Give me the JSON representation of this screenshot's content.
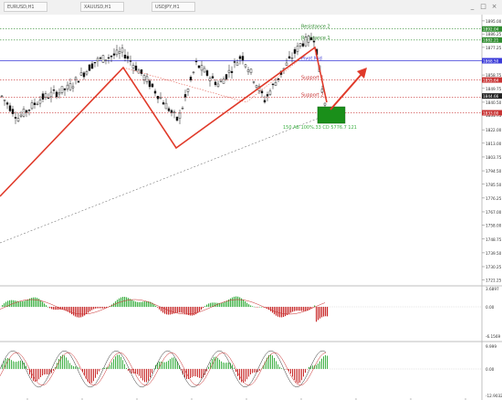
{
  "window": {
    "tabs": [
      "EURUSD,H1",
      "XAUUSD,H1",
      "USDJPY,H1"
    ],
    "controls": {
      "minimize": "_",
      "maximize": "□",
      "close": "×"
    }
  },
  "price_axis": {
    "ticks": [
      "1895.00",
      "1886.25",
      "1877.25",
      "1868.50",
      "1858.75",
      "1849.75",
      "1840.50",
      "1831.75",
      "1822.00",
      "1813.00",
      "1803.75",
      "1794.50",
      "1785.50",
      "1776.25",
      "1767.00",
      "1758.00",
      "1748.75",
      "1739.50",
      "1730.25",
      "1721.25"
    ],
    "current_price": "1844.66",
    "colors": {
      "bull": "#1a1a1a",
      "bear": "#1a1a1a",
      "grid": "#dcdcdc"
    }
  },
  "levels": [
    {
      "label": "Resistance 2",
      "value": 1889.6,
      "color": "#2e8b2e",
      "style": "dotted",
      "tag": "1892.04"
    },
    {
      "label": "Resistance 1",
      "value": 1882.2,
      "color": "#2e8b2e",
      "style": "dotted",
      "tag": "1882.21"
    },
    {
      "label": "Pivot Mid",
      "value": 1868.3,
      "color": "#3a3ad8",
      "style": "solid",
      "tag": "1868.50"
    },
    {
      "label": "Support 1",
      "value": 1855.4,
      "color": "#c83232",
      "style": "dotted",
      "tag": "1855.64"
    },
    {
      "label": "Support 2",
      "value": 1843.8,
      "color": "#c83232",
      "style": "dotted",
      "tag": ""
    },
    {
      "label": "",
      "value": 1833.4,
      "color": "#c83232",
      "style": "dotted",
      "tag": "1833.00"
    }
  ],
  "annotation": {
    "text": "150   AB 100%.33 CD 5776.7   121",
    "color": "#3cb043"
  },
  "indicators": {
    "macd": {
      "ticks": [
        "3.6897",
        "0.00",
        "-6.1569"
      ]
    },
    "stochastic": {
      "ticks": [
        "9.999",
        "0.00",
        "-12.9032"
      ]
    }
  },
  "colors": {
    "zigzag": "#e03a2a",
    "target_box": "#1a8f1a",
    "arrow": "#e03a2a",
    "trendline": "#555555"
  }
}
